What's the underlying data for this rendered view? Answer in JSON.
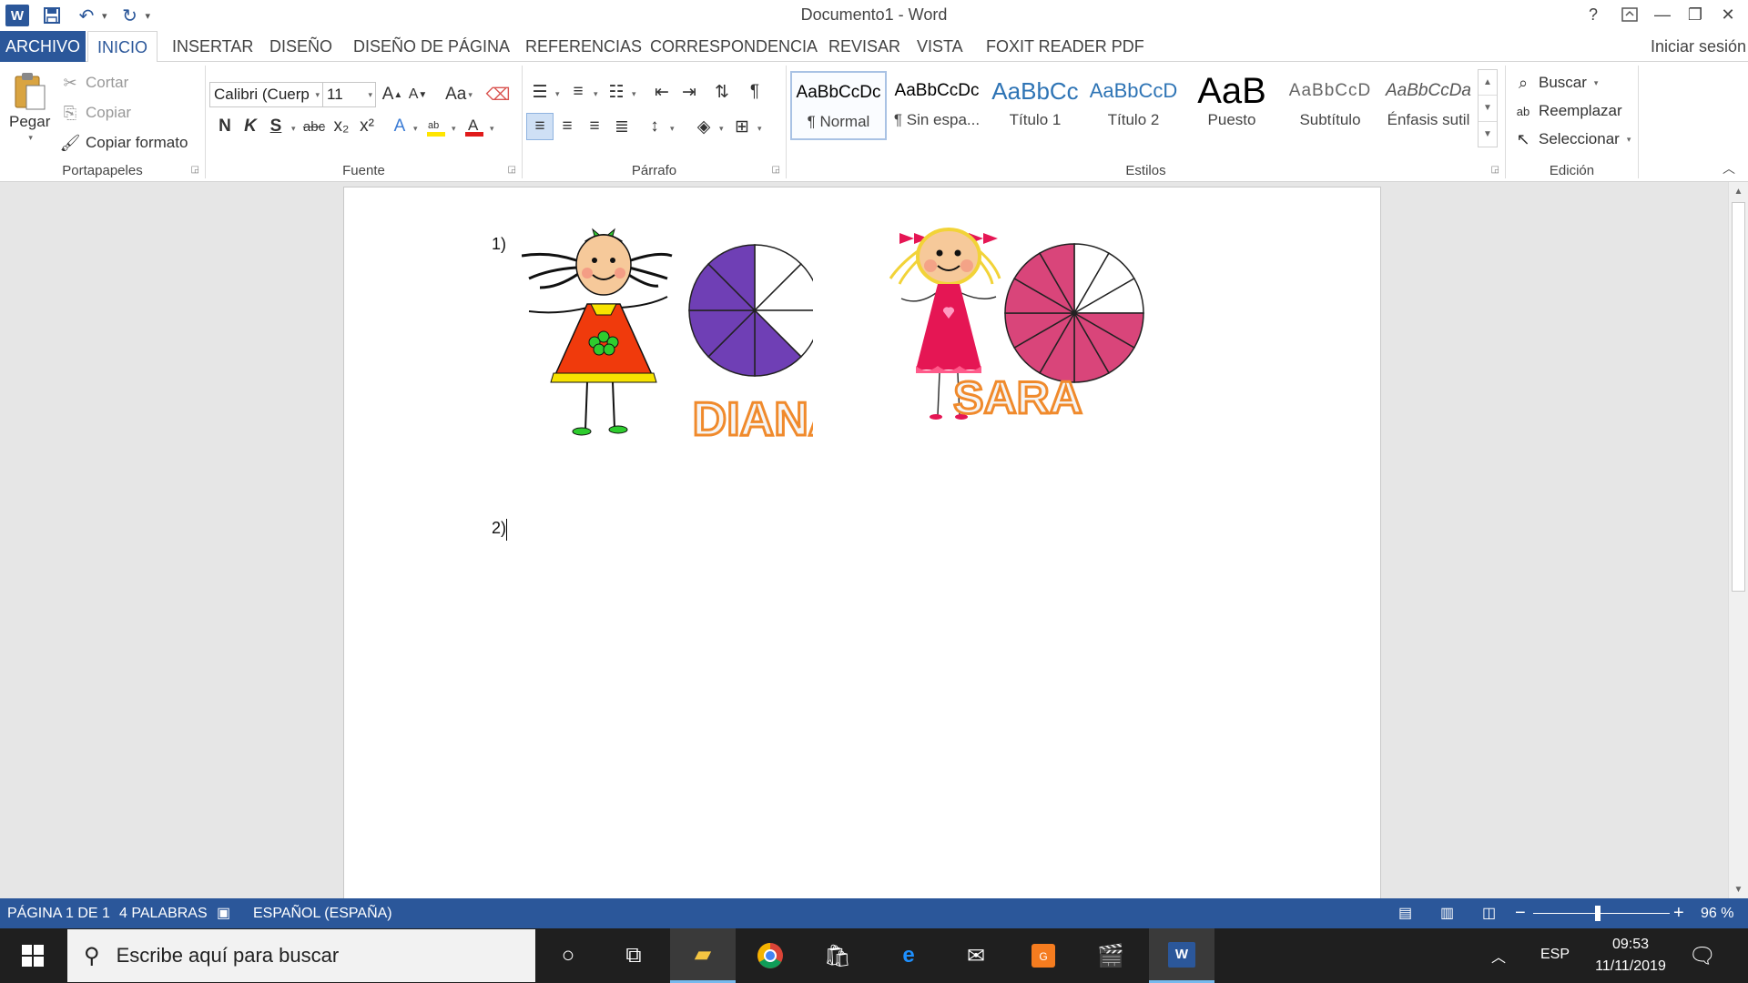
{
  "window": {
    "title": "Documento1 - Word"
  },
  "qat": {
    "app_icon": "W"
  },
  "tabs": {
    "file": "ARCHIVO",
    "items": [
      "INICIO",
      "INSERTAR",
      "DISEÑO",
      "DISEÑO DE PÁGINA",
      "REFERENCIAS",
      "CORRESPONDENCIA",
      "REVISAR",
      "VISTA",
      "FOXIT READER PDF"
    ],
    "active": "INICIO",
    "sign_in": "Iniciar sesión"
  },
  "ribbon": {
    "clipboard": {
      "label": "Portapapeles",
      "paste": "Pegar",
      "cut": "Cortar",
      "copy": "Copiar",
      "format_painter": "Copiar formato"
    },
    "font": {
      "label": "Fuente",
      "font_name": "Calibri (Cuerp",
      "font_size": "11",
      "bold": "N",
      "italic": "K",
      "underline": "S",
      "strike": "abc",
      "subscript": "x₂",
      "superscript": "x²",
      "change_case": "Aa"
    },
    "paragraph": {
      "label": "Párrafo"
    },
    "styles": {
      "label": "Estilos",
      "items": [
        {
          "sample": "AaBbCcDc",
          "name": "¶ Normal"
        },
        {
          "sample": "AaBbCcDc",
          "name": "¶ Sin espa..."
        },
        {
          "sample": "AaBbCc",
          "name": "Título 1"
        },
        {
          "sample": "AaBbCcD",
          "name": "Título 2"
        },
        {
          "sample": "AaB",
          "name": "Puesto"
        },
        {
          "sample": "AaBbCcD",
          "name": "Subtítulo"
        },
        {
          "sample": "AaBbCcDa",
          "name": "Énfasis sutil"
        }
      ]
    },
    "editing": {
      "label": "Edición",
      "find": "Buscar",
      "replace": "Reemplazar",
      "select": "Seleccionar"
    }
  },
  "document": {
    "items": [
      {
        "number": "1)",
        "names": [
          "DIANA",
          "SARA"
        ]
      },
      {
        "number": "2)"
      }
    ],
    "colors": {
      "diana_pie": "#6f3fb5",
      "sara_pie": "#d9457a",
      "name_fill": "#f5f5f5",
      "name_stroke": "#f08a2c"
    },
    "pies": [
      {
        "name": "DIANA",
        "parts": 8,
        "shaded": 5
      },
      {
        "name": "SARA",
        "parts": 12,
        "shaded": 9
      }
    ]
  },
  "status": {
    "page": "PÁGINA 1 DE 1",
    "words": "4 PALABRAS",
    "language": "ESPAÑOL (ESPAÑA)",
    "zoom": "96 %",
    "zoom_minus": "−",
    "zoom_plus": "+"
  },
  "taskbar": {
    "search_placeholder": "Escribe aquí para buscar",
    "lang": "ESP",
    "time": "09:53",
    "date": "11/11/2019"
  }
}
